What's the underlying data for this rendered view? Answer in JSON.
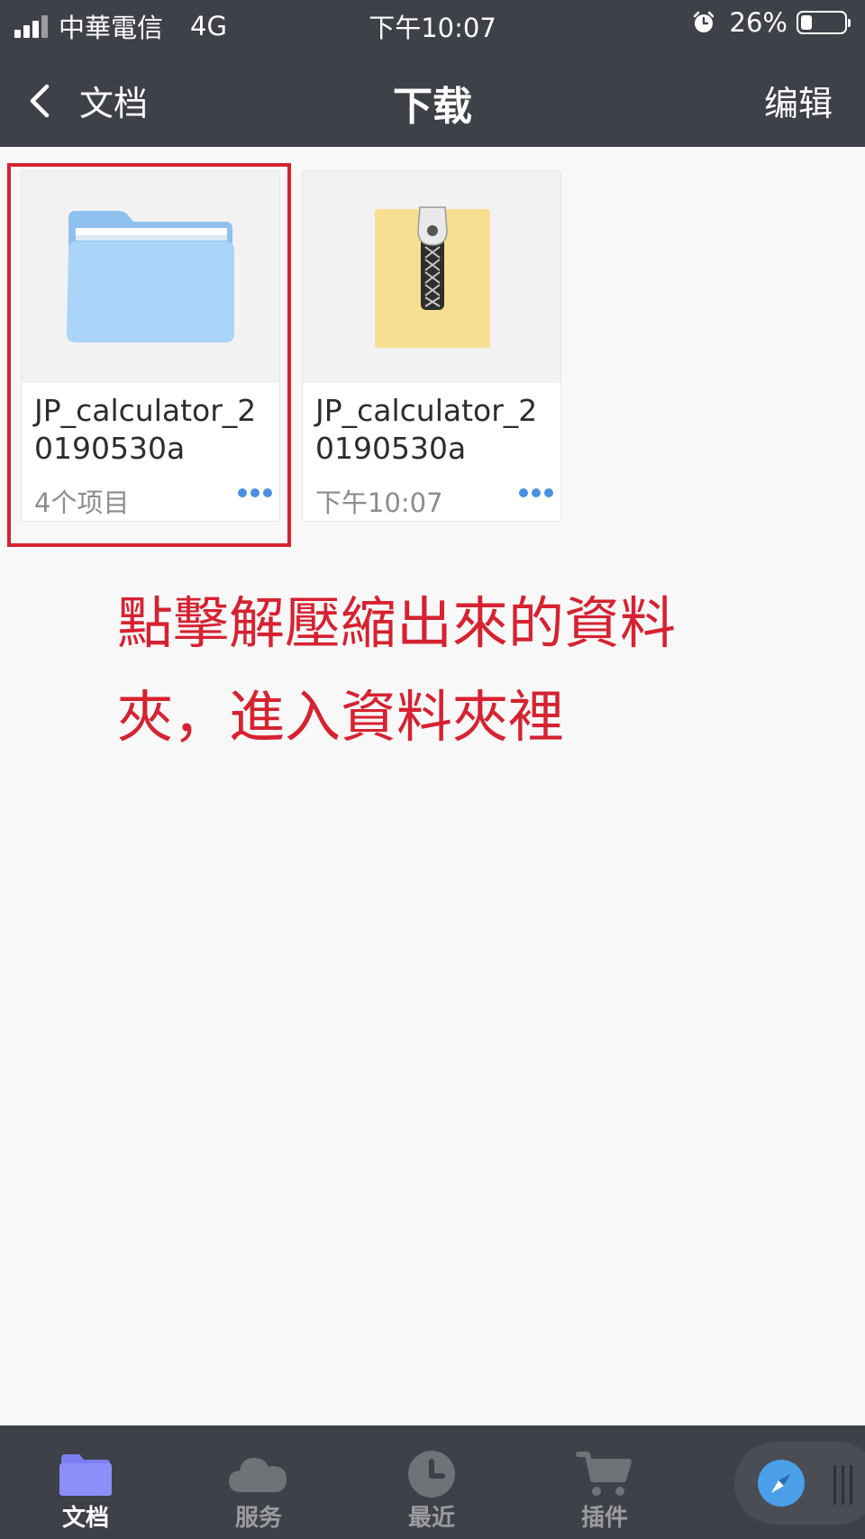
{
  "status_bar": {
    "carrier": "中華電信",
    "network": "4G",
    "time": "下午10:07",
    "battery_percent": "26%",
    "battery_level": 0.26
  },
  "nav": {
    "back_label": "文档",
    "title": "下载",
    "edit_label": "编辑"
  },
  "files": [
    {
      "name": "JP_calculator_20190530a",
      "type": "folder",
      "meta": "4个项目",
      "icon": "folder-icon",
      "icon_color": "#aad4f8"
    },
    {
      "name": "JP_calculator_20190530a",
      "type": "zip",
      "meta": "下午10:07",
      "icon": "zip-archive-icon",
      "icon_color": "#f7df91"
    }
  ],
  "annotation": {
    "line1": "點擊解壓縮出來的資料",
    "line2": "夾，進入資料夾裡",
    "color": "#d62231"
  },
  "tabs": [
    {
      "label": "文档",
      "icon": "folder-icon",
      "active": true
    },
    {
      "label": "服务",
      "icon": "cloud-icon",
      "active": false
    },
    {
      "label": "最近",
      "icon": "clock-icon",
      "active": false
    },
    {
      "label": "插件",
      "icon": "cart-icon",
      "active": false
    }
  ],
  "floating_button": {
    "icon": "compass-icon"
  },
  "colors": {
    "header_bg": "#3e4147",
    "accent_blue": "#4a90e2",
    "active_tab_icon": "#8b8ff8",
    "highlight_red": "#d62231"
  }
}
